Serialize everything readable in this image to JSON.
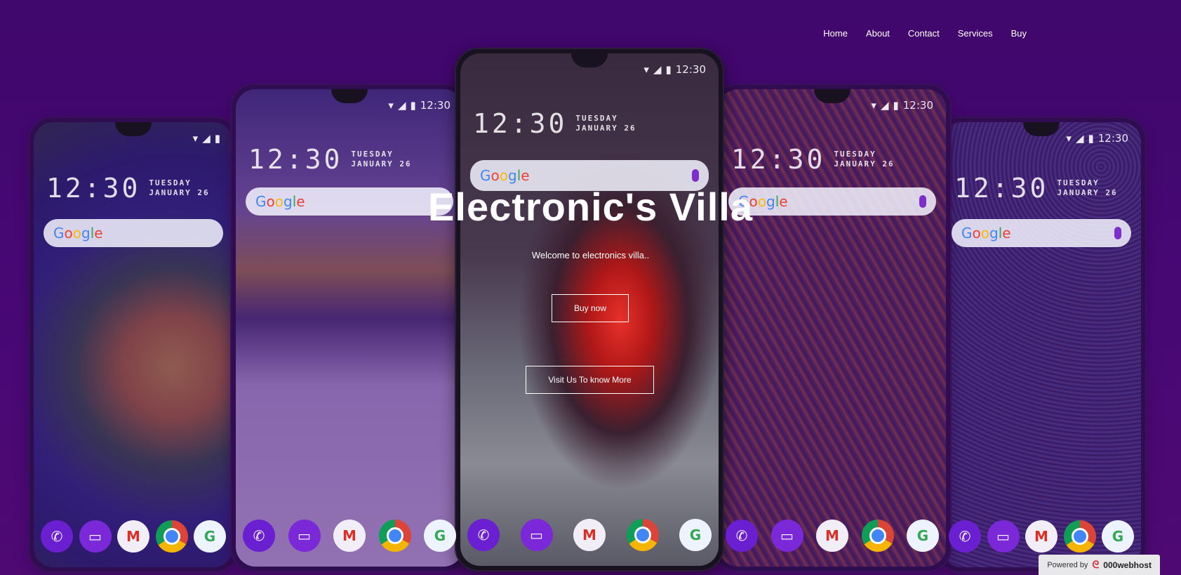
{
  "nav": {
    "home": "Home",
    "about": "About",
    "contact": "Contact",
    "services": "Services",
    "buy": "Buy"
  },
  "hero": {
    "title": "Electronic's Villa",
    "subtitle": "Welcome to electronics villa..",
    "buy_button": "Buy now",
    "visit_button": "Visit Us To know More"
  },
  "phone": {
    "status_time": "12:30",
    "clock_time": "12:30",
    "day": "TUESDAY",
    "date": "JANUARY 26",
    "google_letters": [
      "G",
      "o",
      "o",
      "g",
      "l",
      "e"
    ]
  },
  "footer": {
    "powered_by": "Powered by",
    "host": "000webhost"
  },
  "colors": {
    "background": "#4a0870",
    "overlay": "rgba(70,10,120,0.55)"
  }
}
